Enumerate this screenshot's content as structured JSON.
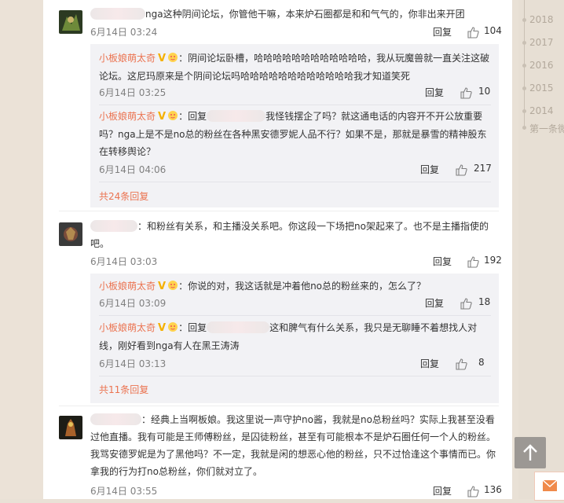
{
  "timeline": {
    "years": [
      "2018",
      "2017",
      "2016",
      "2015",
      "2014"
    ],
    "first_item": "第一条微"
  },
  "comments": [
    {
      "text": "nga这种阴间论坛，你管他干嘛，本来炉石圈都是和和气气的，你非出来开团",
      "time": "6月14日 03:24",
      "reply_label": "回复",
      "likes": "104"
    },
    {
      "text": "和粉丝有关系，和主播没关系吧。你这段一下场把no架起来了。也不是主播指使的吧。",
      "time": "6月14日 03:03",
      "reply_label": "回复",
      "likes": "192"
    },
    {
      "text": "经典上当啊板娘。我这里说一声守护no酱，我就是no总粉丝吗？实际上我甚至没看过他直播。我有可能是王师傅粉丝，是囚徒粉丝，甚至有可能根本不是炉石圈任何一个人的粉丝。我骂安德罗妮是为了黑他吗？不一定，我就是闲的想恶心他的粉丝，只不过恰逢这个事情而已。你拿我的行为打no总粉丝，你们就对立了。",
      "time": "6月14日 03:55",
      "reply_label": "回复",
      "likes": "136"
    }
  ],
  "replies_group1": [
    {
      "author": "小板娘萌太奇",
      "text": "：阴间论坛卧槽，哈哈哈哈哈哈哈哈哈哈哈哈，我从玩魔兽就一直关注这破论坛。这尼玛原来是个阴间论坛吗哈哈哈哈哈哈哈哈哈哈哈哈我才知道笑死",
      "time": "6月14日 03:25",
      "reply_label": "回复",
      "likes": "10"
    },
    {
      "author": "小板娘萌太奇",
      "text_prefix": "：回复",
      "text": "我怪钱摆企了吗？就这通电话的内容开不开公放重要吗？nga上是不是no总的粉丝在各种黑安德罗妮人品不行？如果不是，那就是暴雪的精神股东在转移舆论？",
      "time": "6月14日 04:06",
      "reply_label": "回复",
      "likes": "217"
    }
  ],
  "more_group1": "共24条回复",
  "replies_group2": [
    {
      "author": "小板娘萌太奇",
      "text": "：你说的对，我这话就是冲着他no总的粉丝来的，怎么了？",
      "time": "6月14日 03:09",
      "reply_label": "回复",
      "likes": "18"
    },
    {
      "author": "小板娘萌太奇",
      "text_prefix": "：回复",
      "text": "这和脾气有什么关系，我只是无聊睡不着想找人对线，刚好看到nga有人在黑王涛涛",
      "time": "6月14日 03:13",
      "reply_label": "回复",
      "likes": "8"
    }
  ],
  "more_group2": "共11条回复",
  "colors": {
    "accent": "#eb7350",
    "vip": "#f4b000",
    "bg": "#e9e1d6"
  }
}
